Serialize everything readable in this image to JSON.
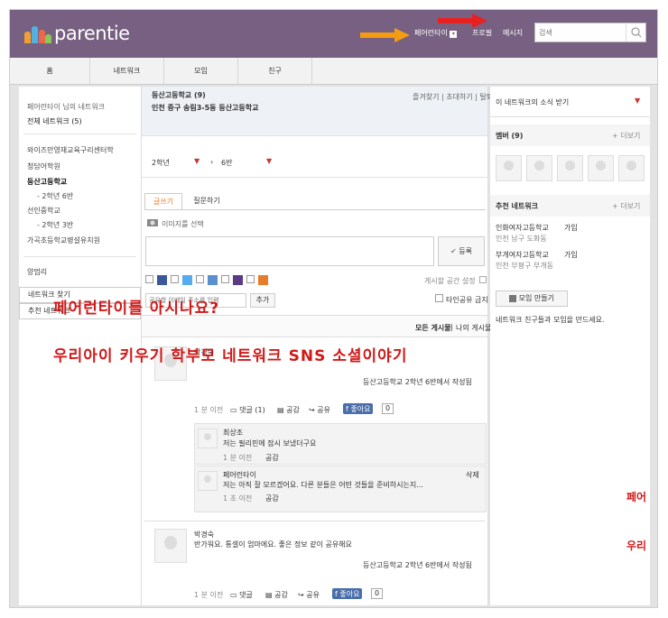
{
  "header": {
    "logo_text": "parentie",
    "nav_user": "페어런타이",
    "nav_profile": "프로필",
    "nav_message": "메시지",
    "search_placeholder": "검색"
  },
  "topnav": [
    "홈",
    "네트워크",
    "모임",
    "친구"
  ],
  "left_sidebar": {
    "title": "페어런타이 님의 네트워크",
    "all_networks": "전체 네트워크 (5)",
    "items": [
      "와이즈만영재교육구리센터학",
      "청담어학원",
      "등산고등학교",
      "- 2학년 6반",
      "선인중학교",
      "- 2학년 3반",
      "가곡초등학교병설유치원"
    ],
    "friend": "양멈리",
    "network_find": "네트워크 찾기",
    "recommended": "추천 네트워크"
  },
  "network": {
    "name": "등산고등학교 (9)",
    "address": "인천 중구 송림3-5동 등산고등학교",
    "actions": "즐겨찾기 | 초대하기 | 탈퇴",
    "grade": "2학년",
    "class": "6반"
  },
  "post_box": {
    "tab_write": "글쓰기",
    "tab_question": "질문하기",
    "image_select": "이미지를 선택",
    "submit": "등록",
    "share_settings": "게시할 공간 설정",
    "share_input_placeholder": "공유할 이메일 주소를 입력",
    "add": "추가",
    "no_share": "타인공유 금지"
  },
  "feed_filter": {
    "all": "모든 게시물",
    "mine": "나의 게시물"
  },
  "posts": [
    {
      "author": "박경숙",
      "text": "",
      "meta": "등산고등학교 2학년 6반에서 작성됨",
      "time": "1 분 이전",
      "comment": "댓글 (1)",
      "like": "공감",
      "share": "공유",
      "fb": "좋아요",
      "fb_count": "0"
    },
    {
      "author": "박경숙",
      "text": "반가워요. 통셀이 엄마에요. 좋은 정보 같이 공유해요",
      "meta": "등산고등학교 2학년 6반에서 작성됨",
      "time": "1 분 이전",
      "comment": "댓글",
      "like": "공감",
      "share": "공유",
      "fb": "좋아요",
      "fb_count": "0"
    }
  ],
  "comments": [
    {
      "author": "최상조",
      "text": "저는 필리핀에 잠시 보냈더구요",
      "time": "1 분 이전",
      "like": "공감"
    },
    {
      "author": "페어런타이",
      "text": "저는 아직 잘 모르겠어요. 다른 분들은 어떤 것들을 준비하시는지...",
      "time": "1 초 이전",
      "like": "공감",
      "delete": "삭제"
    }
  ],
  "right_sidebar": {
    "news_header": "이 네트워크의 소식 받기",
    "members": "멤버 (9)",
    "more": "+ 더보기",
    "recommended_title": "추천 네트워크",
    "rec": [
      {
        "name": "인화여자고등학교",
        "join": "가입",
        "loc": "인천 남구 도화동"
      },
      {
        "name": "부개여자고등학교",
        "join": "가입",
        "loc": "인천 부평구 부개동"
      }
    ],
    "create_group": "모임 만들기",
    "create_desc": "네트워크 친구들과 모임을 만드세요."
  },
  "overlay": {
    "line1": "페어런타이를 아시나요?",
    "line2": "우리아이 키우기 학부모 네트워크 SNS 소셜이야기",
    "edge1": "페어",
    "edge2": "우리"
  },
  "colors": {
    "header": "#776081",
    "accent_arrow": "#f39c12",
    "red_arrow": "#e82020",
    "annotation": "#d11919"
  }
}
